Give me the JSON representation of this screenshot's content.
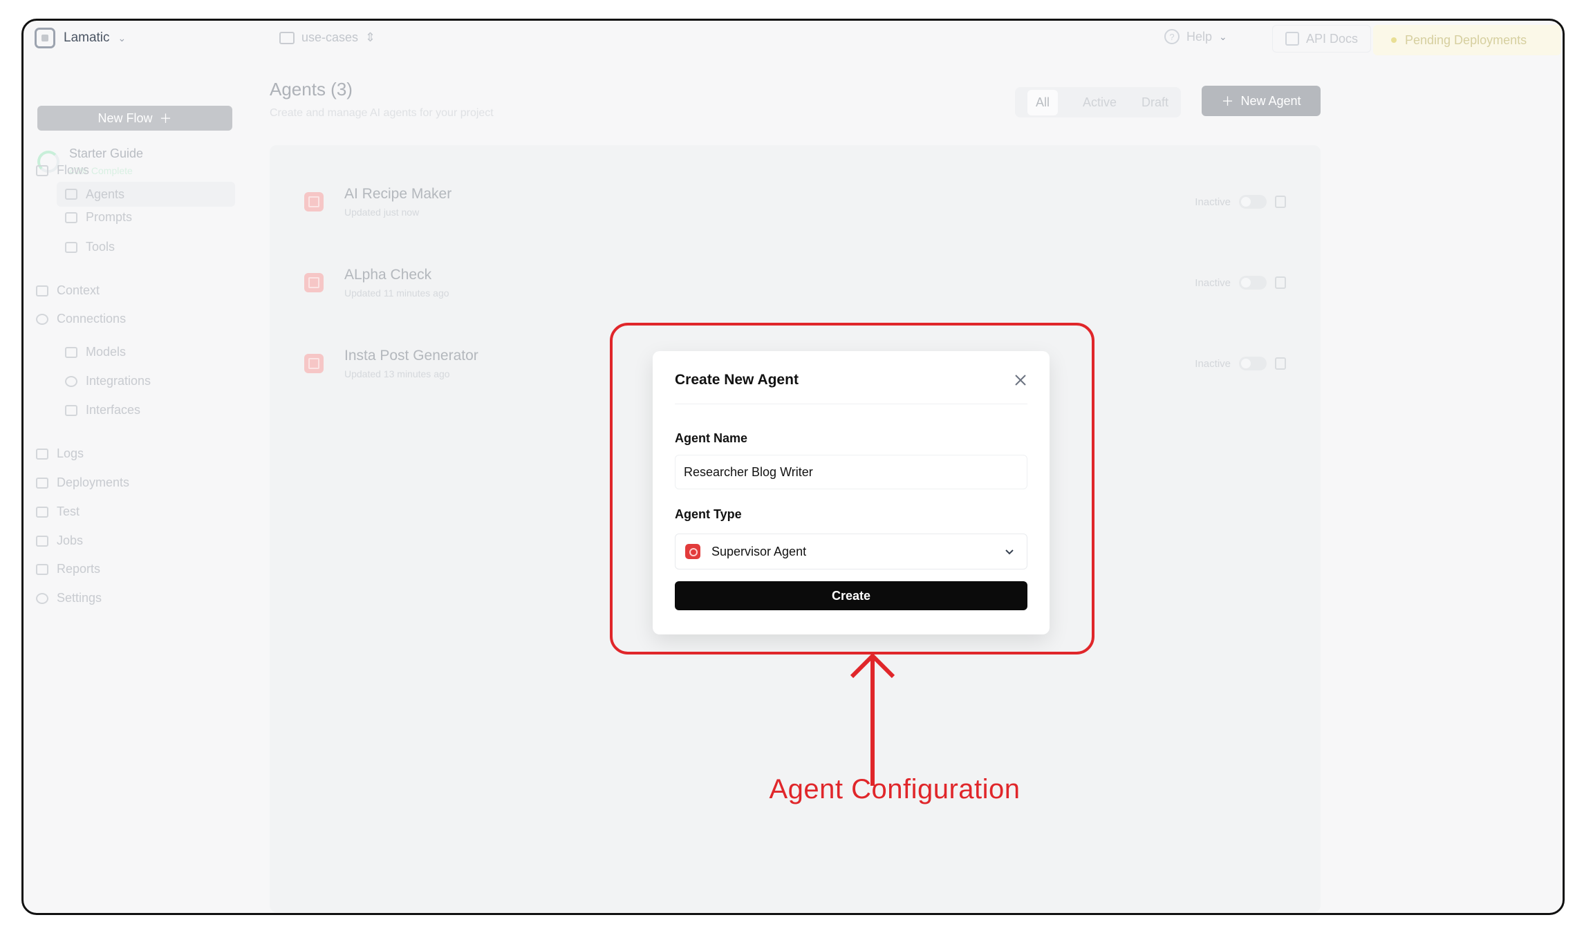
{
  "topbar": {
    "brand": "Lamatic",
    "project": "use-cases",
    "help": "Help",
    "api_docs": "API Docs",
    "pending": "Pending Deployments"
  },
  "sidebar": {
    "new_flow": "New Flow",
    "starter_title": "Starter Guide",
    "starter_sub": "40% Complete",
    "flows": "Flows",
    "agents": "Agents",
    "prompts": "Prompts",
    "tools": "Tools",
    "context": "Context",
    "connections": "Connections",
    "models": "Models",
    "integrations": "Integrations",
    "interfaces": "Interfaces",
    "logs": "Logs",
    "deployments": "Deployments",
    "test": "Test",
    "jobs": "Jobs",
    "reports": "Reports",
    "settings": "Settings"
  },
  "main": {
    "title": "Agents (3)",
    "subtitle": "Create and manage AI agents for your project",
    "filters": [
      "All",
      "Active",
      "Draft"
    ],
    "new_agent": "New Agent",
    "agents": [
      {
        "name": "AI Recipe Maker",
        "updated": "Updated just now",
        "status": "Inactive"
      },
      {
        "name": "ALpha Check",
        "updated": "Updated 11 minutes ago",
        "status": "Inactive"
      },
      {
        "name": "Insta Post Generator",
        "updated": "Updated 13 minutes ago",
        "status": "Inactive"
      }
    ]
  },
  "modal": {
    "title": "Create New Agent",
    "agent_name_label": "Agent Name",
    "agent_name_value": "Researcher Blog Writer",
    "agent_type_label": "Agent Type",
    "agent_type_value": "Supervisor Agent",
    "create": "Create"
  },
  "annotation": {
    "label": "Agent Configuration",
    "color": "#e0262a"
  },
  "icons": [
    "lamatic-logo-icon",
    "folder-icon",
    "help-icon",
    "doc-icon",
    "plus-icon",
    "close-icon",
    "chevron-down-icon",
    "copy-icon",
    "supervisor-agent-icon"
  ]
}
